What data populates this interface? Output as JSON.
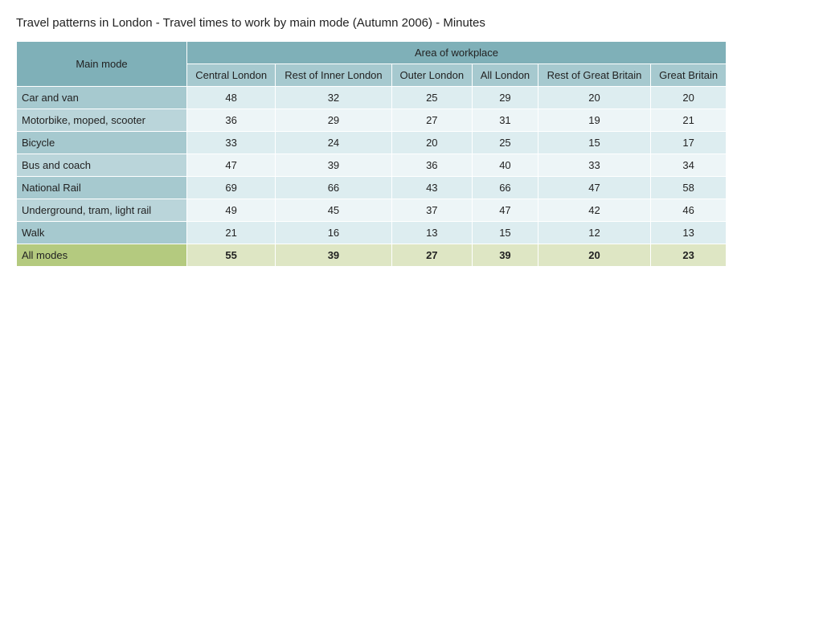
{
  "title": "Travel patterns in London - Travel times to work by main mode (Autumn 2006) - Minutes",
  "headers": {
    "main_mode": "Main mode",
    "area_group": "Area of workplace",
    "cols": [
      "Central London",
      "Rest of Inner London",
      "Outer London",
      "All London",
      "Rest of Great Britain",
      "Great Britain"
    ]
  },
  "rows": [
    {
      "mode": "Car and van",
      "values": [
        48,
        32,
        25,
        29,
        20,
        20
      ]
    },
    {
      "mode": "Motorbike, moped, scooter",
      "values": [
        36,
        29,
        27,
        31,
        19,
        21
      ]
    },
    {
      "mode": "Bicycle",
      "values": [
        33,
        24,
        20,
        25,
        15,
        17
      ]
    },
    {
      "mode": "Bus and coach",
      "values": [
        47,
        39,
        36,
        40,
        33,
        34
      ]
    },
    {
      "mode": "National Rail",
      "values": [
        69,
        66,
        43,
        66,
        47,
        58
      ]
    },
    {
      "mode": "Underground, tram, light rail",
      "values": [
        49,
        45,
        37,
        47,
        42,
        46
      ]
    },
    {
      "mode": "Walk",
      "values": [
        21,
        16,
        13,
        15,
        12,
        13
      ]
    }
  ],
  "total_row": {
    "mode": "All modes",
    "values": [
      55,
      39,
      27,
      39,
      20,
      23
    ]
  },
  "chart_data": {
    "type": "table",
    "title": "Travel patterns in London - Travel times to work by main mode (Autumn 2006) - Minutes",
    "columns": [
      "Main mode",
      "Central London",
      "Rest of Inner London",
      "Outer London",
      "All London",
      "Rest of Great Britain",
      "Great Britain"
    ],
    "rows": [
      [
        "Car and van",
        48,
        32,
        25,
        29,
        20,
        20
      ],
      [
        "Motorbike, moped, scooter",
        36,
        29,
        27,
        31,
        19,
        21
      ],
      [
        "Bicycle",
        33,
        24,
        20,
        25,
        15,
        17
      ],
      [
        "Bus and coach",
        47,
        39,
        36,
        40,
        33,
        34
      ],
      [
        "National Rail",
        69,
        66,
        43,
        66,
        47,
        58
      ],
      [
        "Underground, tram, light rail",
        49,
        45,
        37,
        47,
        42,
        46
      ],
      [
        "Walk",
        21,
        16,
        13,
        15,
        12,
        13
      ],
      [
        "All modes",
        55,
        39,
        27,
        39,
        20,
        23
      ]
    ]
  }
}
